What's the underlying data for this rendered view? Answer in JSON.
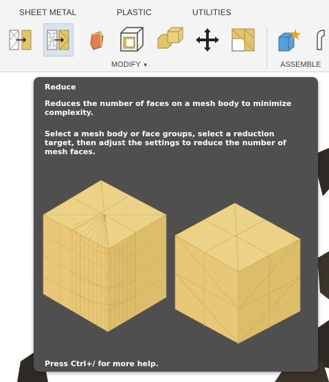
{
  "toolbar": {
    "tabs": [
      "SHEET METAL",
      "PLASTIC",
      "UTILITIES"
    ],
    "group_modify": "MODIFY",
    "group_assemble": "ASSEMBLE",
    "tools": [
      "convert-icon",
      "reduce-icon",
      "remesh-icon",
      "shell-icon",
      "combine-icon",
      "move-icon",
      "plane-cut-icon",
      "new-component-icon",
      "joint-icon"
    ]
  },
  "tooltip": {
    "title": "Reduce",
    "description_1": "Reduces the number of faces on a mesh body to minimize complexity.",
    "description_2": "Select a mesh body or face groups, select a reduction target, then adjust the settings to reduce the number of mesh faces.",
    "help": "Press Ctrl+/ for more help."
  },
  "colors": {
    "tooltip_bg": "#4f4f4f",
    "mesh_face": "#e6c876",
    "mesh_face_dark": "#d4b25e",
    "mesh_edge": "#b89a4c"
  }
}
